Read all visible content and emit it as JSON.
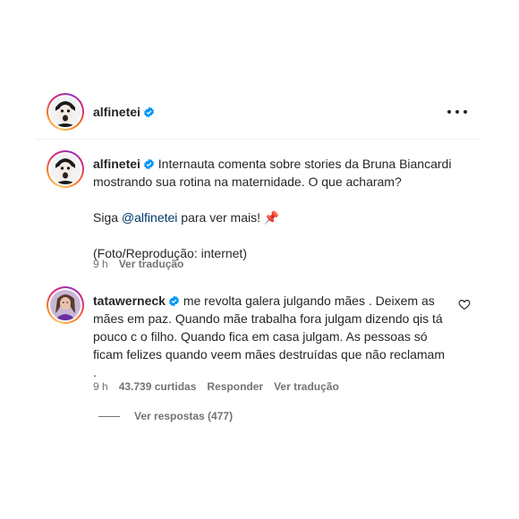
{
  "post": {
    "username": "alfinetei",
    "more_icon": "more-horizontal-icon"
  },
  "caption": {
    "username": "alfinetei",
    "line1": "Internauta comenta sobre stories da Bruna Biancardi",
    "line2": "mostrando sua rotina na maternidade. O que acharam?",
    "follow_prefix": "Siga ",
    "follow_handle": "@alfinetei",
    "follow_suffix": " para ver mais! ",
    "pin_emoji": "📌",
    "credit": "(Foto/Reprodução: internet)",
    "time": "9 h",
    "translate": "Ver tradução"
  },
  "comment": {
    "username": "tatawerneck",
    "line1": "me revolta galera julgando mães . Deixem as",
    "line2": "mães em paz. Quando mãe trabalha fora julgam dizendo qis tá",
    "line3": "pouco c o filho. Quando fica em casa julgam. As pessoas só",
    "line4": "ficam felizes quando veem mães destruídas que não reclamam",
    "line5": ".",
    "time": "9 h",
    "likes": "43.739 curtidas",
    "reply": "Responder",
    "translate": "Ver tradução",
    "view_replies": "Ver respostas (477)"
  },
  "colors": {
    "verified": "#0095f6",
    "link": "#00376b",
    "meta": "#737373"
  }
}
